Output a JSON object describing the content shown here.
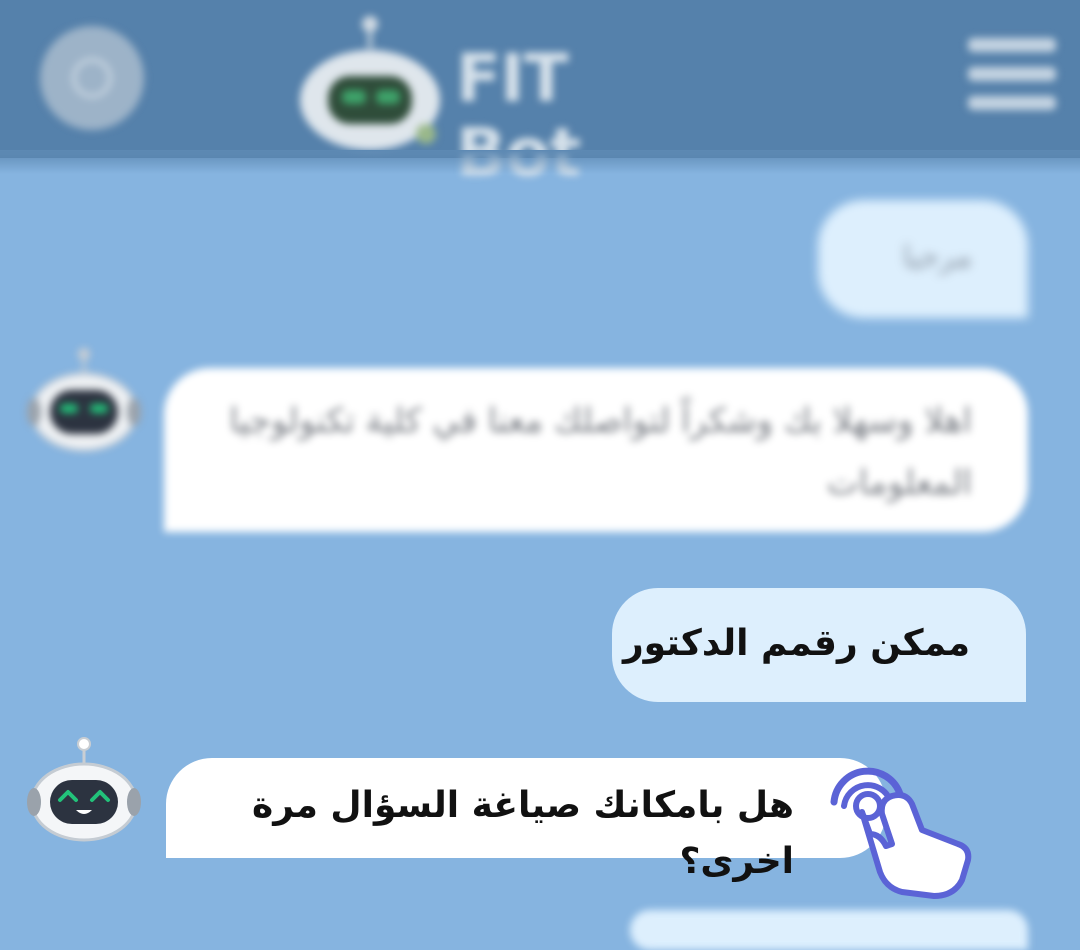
{
  "header": {
    "brand_name": "FIT Bot",
    "settings_icon": "settings-circle-icon",
    "menu_icon": "hamburger-menu-icon",
    "logo_icon": "robot-logo-icon"
  },
  "messages": [
    {
      "sender": "user",
      "text": "مرحبا"
    },
    {
      "sender": "bot",
      "text": "اهلا وسهلا بك وشكراً لتواصلك معنا في كلية تكنولوجيا المعلومات"
    },
    {
      "sender": "user",
      "text": "ممكن رقمم الدكتور"
    },
    {
      "sender": "bot",
      "text": "هل بامكانك صياغة السؤال مرة اخرى؟"
    }
  ],
  "overlay": {
    "tap_hint_icon": "tap-hand-icon"
  },
  "colors": {
    "background": "#86b4e0",
    "header": "#5581ab",
    "user_bubble": "#ddeffd",
    "bot_bubble": "#ffffff",
    "tap_hint": "#5b63d6",
    "bot_eyes": "#22c37a"
  }
}
